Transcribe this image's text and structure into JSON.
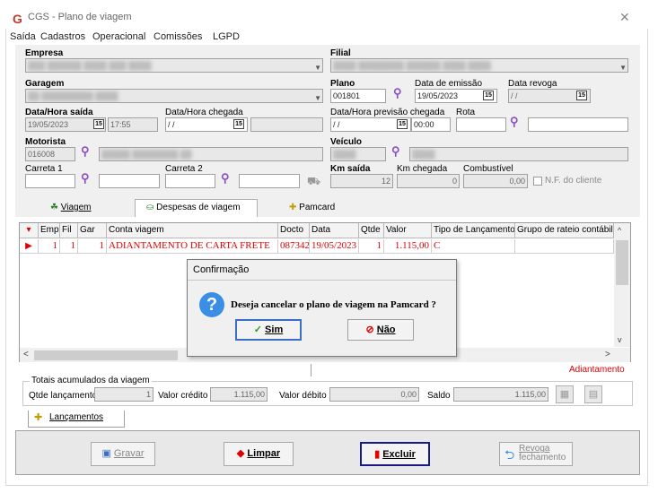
{
  "window": {
    "logo": "G",
    "title": "CGS - Plano de viagem",
    "close": "✕"
  },
  "menu": [
    "Saída",
    "Cadastros",
    "Operacional",
    "Comissões",
    "LGPD"
  ],
  "form": {
    "empresa_label": "Empresa",
    "filial_label": "Filial",
    "garagem_label": "Garagem",
    "plano_label": "Plano",
    "plano_value": "001801",
    "data_emissao_label": "Data de emissão",
    "data_emissao_value": "19/05/2023",
    "data_revoga_label": "Data revoga",
    "data_revoga_value": "/ /",
    "data_hora_saida_label": "Data/Hora saída",
    "data_saida_value": "19/05/2023",
    "hora_saida_value": "17:55",
    "data_hora_chegada_label": "Data/Hora chegada",
    "data_chegada_value": "/ /",
    "previsao_chegada_label": "Data/Hora previsão chegada",
    "previsao_data_value": "/ /",
    "previsao_hora_value": "00:00",
    "rota_label": "Rota",
    "motorista_label": "Motorista",
    "motorista_value": "016008",
    "veiculo_label": "Veículo",
    "carreta1_label": "Carreta 1",
    "carreta2_label": "Carreta 2",
    "km_saida_label": "Km saída",
    "km_saida_value": "12",
    "km_chegada_label": "Km chegada",
    "km_chegada_value": "0",
    "combustivel_label": "Combustível",
    "combustivel_value": "0,00",
    "nf_cliente_label": "N.F. do cliente",
    "calendar_glyph": "15"
  },
  "tabs": [
    "Viagem",
    "Despesas de viagem",
    "Pamcard"
  ],
  "grid": {
    "headers": [
      "Emp",
      "Fil",
      "Gar",
      "Conta viagem",
      "Docto",
      "Data",
      "Qtde",
      "Valor",
      "Tipo de Lançamento",
      "Grupo de rateio contábil"
    ],
    "row": {
      "emp": "1",
      "fil": "1",
      "gar": "1",
      "conta": "ADIANTAMENTO DE CARTA FRETE",
      "docto": "087342",
      "data": "19/05/2023",
      "qtde": "1",
      "valor": "1.115,00",
      "tipo": "C"
    },
    "status": "Adiantamento"
  },
  "totals": {
    "title": "Totais acumulados da viagem",
    "qtde_label": "Qtde lançamento",
    "qtde_value": "1",
    "credito_label": "Valor crédito",
    "credito_value": "1.115,00",
    "debito_label": "Valor débito",
    "debito_value": "0,00",
    "saldo_label": "Saldo",
    "saldo_value": "1.115,00"
  },
  "lancamentos_tab": "Lançamentos",
  "dialog": {
    "title": "Confirmação",
    "message": "Deseja cancelar o plano de viagem na Pamcard ?",
    "yes": "Sim",
    "no": "Não"
  },
  "buttons": {
    "gravar": "Gravar",
    "limpar": "Limpar",
    "excluir": "Excluir",
    "revoga_line1": "Revoga",
    "revoga_line2": "fechamento"
  },
  "colors": {
    "accent_red": "#e00000",
    "magnifier": "#8a4fc4",
    "question_blue": "#3a8ee6"
  }
}
